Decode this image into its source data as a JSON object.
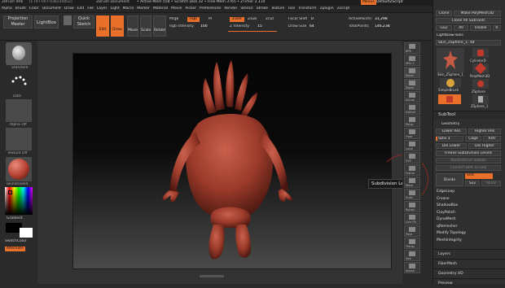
{
  "title_bar": {
    "app": "ZBrush 4R6",
    "doc": "[CT0-FV07-038220852]",
    "document_label": "ZBrush Document",
    "stats": "• Active Mem 558 • Scratch Disk 32 • Free Mem 3765 • ZTimer 2.114",
    "menus_btn": "Menus",
    "script": "DefaultZScript"
  },
  "menus": [
    "Alpha",
    "Brush",
    "Color",
    "Document",
    "Draw",
    "Edit",
    "File",
    "Layer",
    "Light",
    "Macro",
    "Marker",
    "Material",
    "Movie",
    "Picker",
    "Preferences",
    "Render",
    "Stencil",
    "Stroke",
    "Texture",
    "Tool",
    "Transform",
    "Zplugin",
    "Zscript"
  ],
  "toolbar": {
    "projection_master": "Projection Master",
    "lightbox": "LightBox",
    "quick_sketch": "Quick Sketch",
    "edit": "Edit",
    "draw": "Draw",
    "move": "Move",
    "scale": "Scale",
    "rotate": "Rotate",
    "mrgb": "Mrgb",
    "rgb": "Rgb",
    "m": "M",
    "rgb_intensity_label": "Rgb Intensity",
    "rgb_intensity": "100",
    "zadd": "Zadd",
    "zsub": "Zsub",
    "zcut": "Zcut",
    "z_intensity_label": "Z Intensity",
    "z_intensity": "15",
    "focal_shift_label": "Focal Shift",
    "focal_shift": "0",
    "draw_size_label": "Draw Size",
    "draw_size": "64",
    "active_points_label": "ActivePoints:",
    "active_points": "31,298",
    "total_points_label": "TotalPoints:",
    "total_points": "146,238"
  },
  "left_shelf": {
    "brush_label": "Standard",
    "stroke_label": "Dots",
    "alpha_label": "Alpha Off",
    "texture_label": "Texture Off",
    "material_label": "SkinShade4",
    "gradient": "Gradient",
    "switch_color": "SwitchColor",
    "alternate": "Alternate"
  },
  "right_shelf": [
    "BPR",
    "SPix 3",
    "Scroll",
    "Zoom",
    "Actual",
    "AAHalf",
    "Persp",
    "Floor",
    "Local",
    "XYZ",
    "Frame",
    "Move",
    "Scale",
    "Rotate",
    "Line Fill",
    "Polyf",
    "Transp",
    "Solo",
    "Xpose"
  ],
  "tooltip": "Subdivision Level",
  "right_panel": {
    "top_buttons": [
      "Clone",
      "Make PolyMesh3D",
      "Clone All SubTools",
      "GoZ",
      "All",
      "Visible",
      "R"
    ],
    "lightbox_tools": "Lightbox▸Tools",
    "current_tool": "Skin_ZSphere_1: 48",
    "tool_thumbs": [
      "Skin_ZSphere_1",
      "CylinderD",
      "SimpleBrush",
      "PolyMesh3D",
      "ZSphere",
      "ZSphere_1"
    ],
    "subtool": "SubTool",
    "geometry": "Geometry",
    "lower_res": "Lower Res",
    "higher_res": "Higher Res",
    "sdiv_label": "SDiv",
    "sdiv": "1",
    "cage": "Cage",
    "rstr": "Rstr",
    "del_lower": "Del Lower",
    "del_higher": "Del Higher",
    "freeze_subdivision": "Freeze SubDivision Levels",
    "reconstruct_subdiv": "Reconstruct Subdiv",
    "convert_bpr": "Convert BPR To Geo",
    "divide": "Divide",
    "smt": "Smt",
    "suv": "Suv",
    "reuv": "ReUV",
    "list": [
      "EdgeLoop",
      "Crease",
      "ShadowBox",
      "ClayPolish",
      "DynaMesh",
      "qRemesher",
      "Modify Topology",
      "MeshIntegrity"
    ],
    "bottom": [
      "Layers",
      "FiberMesh",
      "Geometry HD",
      "Preview"
    ]
  }
}
